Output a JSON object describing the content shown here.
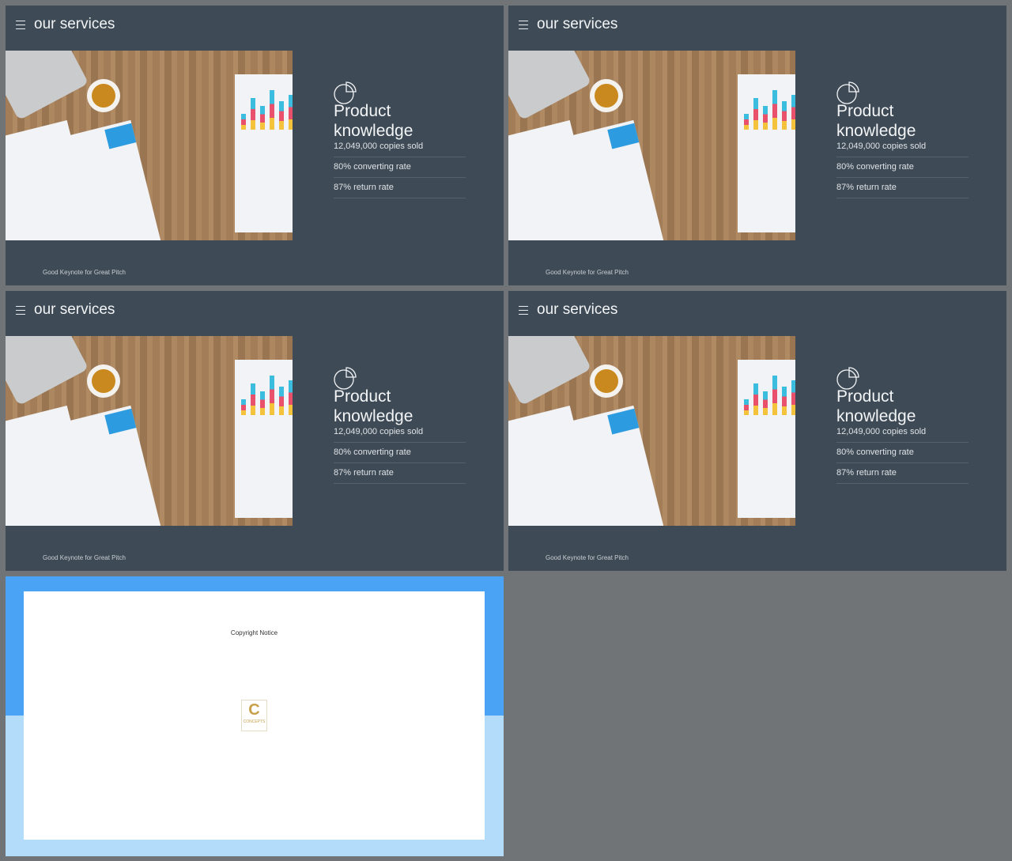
{
  "slides": [
    {
      "title": "our services",
      "heading_line1": "Product",
      "heading_line2": "knowledge",
      "stats": [
        "12,049,000 copies sold",
        "80% converting rate",
        "87% return rate"
      ],
      "footer": "Good Keynote for Great Pitch"
    },
    {
      "title": "our services",
      "heading_line1": "Product",
      "heading_line2": "knowledge",
      "stats": [
        "12,049,000 copies sold",
        "80% converting rate",
        "87% return rate"
      ],
      "footer": "Good Keynote for Great Pitch"
    },
    {
      "title": "our services",
      "heading_line1": "Product",
      "heading_line2": "knowledge",
      "stats": [
        "12,049,000 copies sold",
        "80% converting rate",
        "87% return rate"
      ],
      "footer": "Good Keynote for Great Pitch"
    },
    {
      "title": "our services",
      "heading_line1": "Product",
      "heading_line2": "knowledge",
      "stats": [
        "12,049,000 copies sold",
        "80% converting rate",
        "87% return rate"
      ],
      "footer": "Good Keynote for Great Pitch"
    }
  ],
  "copyright_slide": {
    "notice": "Copyright Notice",
    "logo_text": "CONCEPTS",
    "logo_letter": "C"
  },
  "colors": {
    "background": "#717477",
    "slide": "#3e4a55",
    "accent_blue": "#4aa3f5",
    "light_blue": "#b3dcfb",
    "gold": "#c8a04a"
  },
  "icons": {
    "menu": "hamburger-icon",
    "pie": "pie-chart-icon"
  }
}
